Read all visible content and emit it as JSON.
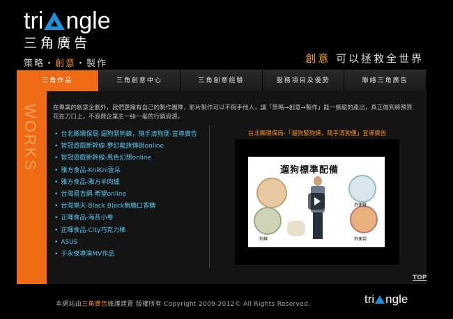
{
  "header": {
    "logo_part1": "tri",
    "logo_part2": "ngle",
    "logo_cn": "三角廣告",
    "sub_a": "策略・",
    "sub_b": "創意",
    "sub_c": "・製作",
    "slogan_a": "創意",
    "slogan_b": " 可以拯救全世界"
  },
  "nav": {
    "items": [
      {
        "label": "三角作品"
      },
      {
        "label": "三角創意中心"
      },
      {
        "label": "三角創意經驗"
      },
      {
        "label": "服務項目及優勢"
      },
      {
        "label": "聯絡三角廣告"
      }
    ]
  },
  "sidebar": {
    "label": "WORKS"
  },
  "intro": {
    "text": "在專業的創意企劃外，我們更擁有自己的製作團隊，影片製作可以不假手他人，讓「策略→創意→製作」能一條龍的產出，真正做到將預算花在刀口上，不浪費企業主一絲一毫的行銷資源。"
  },
  "works": [
    "台北縣環保局-遛狗緊狗鍊，隨手清狗便-宣導廣告",
    "智冠遊戲新幹線-夢幻龍族傳說online",
    "智冠遊戲新幹線-風色幻想online",
    "雅方食品-KniKni雲朵",
    "雅方食品-雅方羊肉爐",
    "台灣易吉網-希望online",
    "台灣樂天-Black Black無糖口香糖",
    "正暉食品-海苔小卷",
    "正暉食品-City巧克力棒",
    "ASUS",
    "于永傑導演MV作品"
  ],
  "video": {
    "title": "台北縣環保局-「遛狗緊狗鍊，隨手清狗便」宣導廣告",
    "frame_title": "遛狗標準配備",
    "label_leash": "狗鍊",
    "label_shovel": "狗便鏟",
    "label_bag": "狗便袋"
  },
  "top_link": "TOP",
  "footer": {
    "prefix": "本網站由",
    "company": "三角廣告",
    "suffix": "維護建置 版權所有 Copyright 2009-2012© All Rights Reserved.",
    "logo_part1": "tri",
    "logo_part2": "ngle"
  },
  "colors": {
    "accent": "#ef6a14",
    "link": "#5bc4ea",
    "logo_blue": "#1f8fd8"
  }
}
